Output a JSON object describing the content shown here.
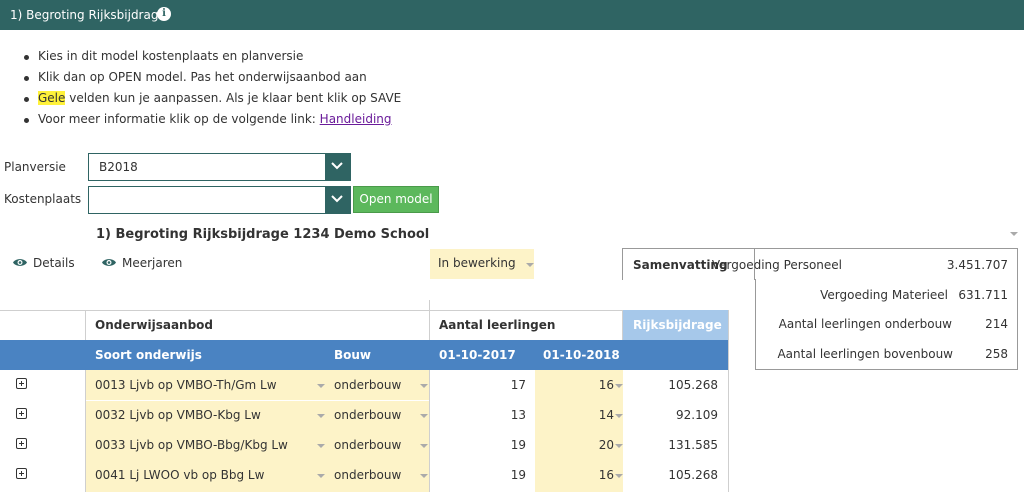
{
  "header": {
    "title": "1) Begroting Rijksbijdrage",
    "info_icon": "info-icon"
  },
  "instructions": {
    "line1": "Kies in dit model kostenplaats en planversie",
    "line2": "Klik dan op OPEN model. Pas het onderwijsaanbod aan",
    "line3_highlight": "Gele",
    "line3_rest": " velden kun je aanpassen. Als je klaar bent klik op SAVE",
    "line4": "Voor meer informatie klik op de volgende link: ",
    "line4_link": "Handleiding"
  },
  "filters": {
    "planversie_label": "Planversie",
    "planversie_value": "B2018",
    "kostenplaats_label": "Kostenplaats",
    "kostenplaats_value": "",
    "open_button": "Open model"
  },
  "model_title": "1) Begroting Rijksbijdrage 1234 Demo School",
  "toggles": {
    "details": "Details",
    "meerjaren": "Meerjaren"
  },
  "status": {
    "value": "In bewerking"
  },
  "summary": {
    "tab_label": "Samenvatting",
    "rows": [
      {
        "label": "Vergoeding Personeel",
        "value": "3.451.707"
      },
      {
        "label": "Vergoeding Materieel",
        "value": "631.711"
      },
      {
        "label": "Aantal leerlingen onderbouw",
        "value": "214"
      },
      {
        "label": "Aantal leerlingen bovenbouw",
        "value": "258"
      }
    ]
  },
  "table": {
    "group_onderwijsaanbod": "Onderwijsaanbod",
    "group_aantal": "Aantal leerlingen",
    "group_rijks": "Rijksbijdrage",
    "col_soort": "Soort onderwijs",
    "col_bouw": "Bouw",
    "col_date1": "01-10-2017",
    "col_date2": "01-10-2018",
    "rows": [
      {
        "soort": "0013 Ljvb op VMBO-Th/Gm Lw",
        "bouw": "onderbouw",
        "y2017": "17",
        "y2018": "16",
        "rijks": "105.268"
      },
      {
        "soort": "0032 Ljvb op VMBO-Kbg Lw",
        "bouw": "onderbouw",
        "y2017": "13",
        "y2018": "14",
        "rijks": "92.109"
      },
      {
        "soort": "0033 Ljvb op VMBO-Bbg/Kbg Lw",
        "bouw": "onderbouw",
        "y2017": "19",
        "y2018": "20",
        "rijks": "131.585"
      },
      {
        "soort": "0041 Lj LWOO vb op Bbg Lw",
        "bouw": "onderbouw",
        "y2017": "19",
        "y2018": "16",
        "rijks": "105.268"
      }
    ]
  }
}
